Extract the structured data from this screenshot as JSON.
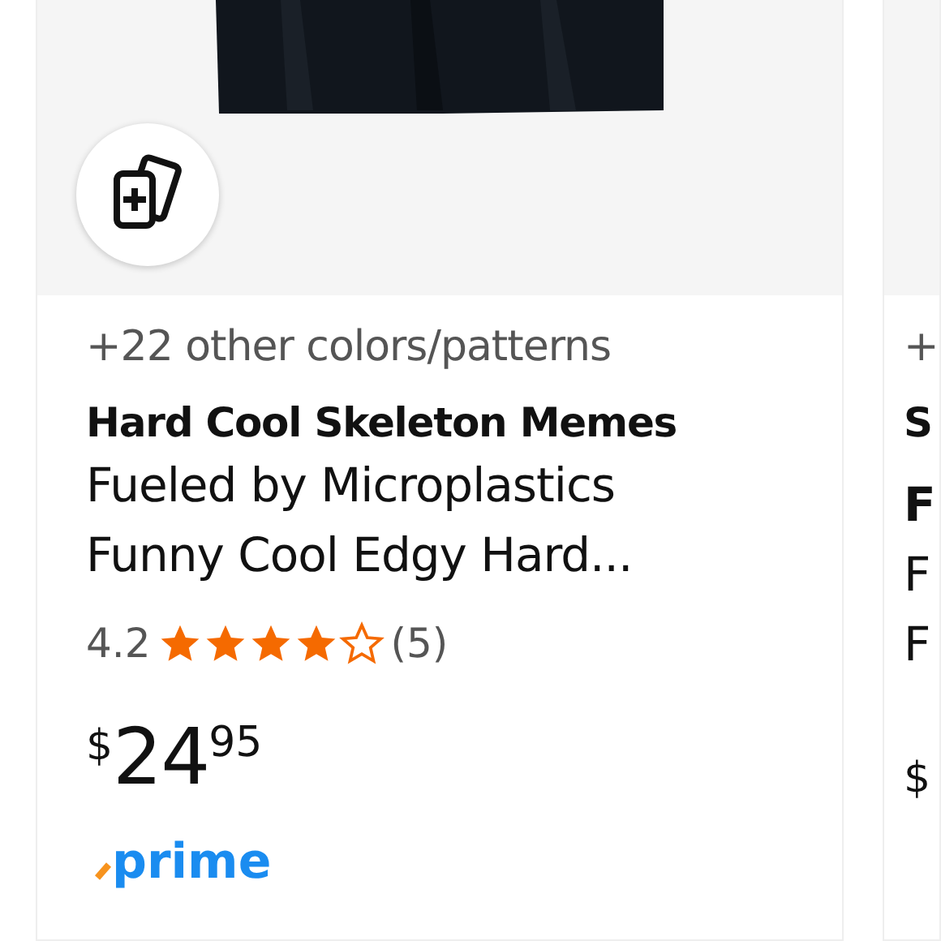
{
  "cards": [
    {
      "colors_note": "+22 other colors/patterns",
      "brand": "Hard Cool Skeleton Memes",
      "title_lines": [
        "Fueled by Microplastics",
        "Funny Cool Edgy Hard..."
      ],
      "rating": "4.2",
      "stars": 4,
      "review_count": "(5)",
      "price": {
        "currency": "$",
        "whole": "24",
        "fraction": "95"
      },
      "prime": "prime"
    },
    {
      "colors_note": "+",
      "brand": "S",
      "title_lines": [
        "F",
        "F",
        "F"
      ],
      "price": {
        "currency": "$"
      }
    }
  ]
}
